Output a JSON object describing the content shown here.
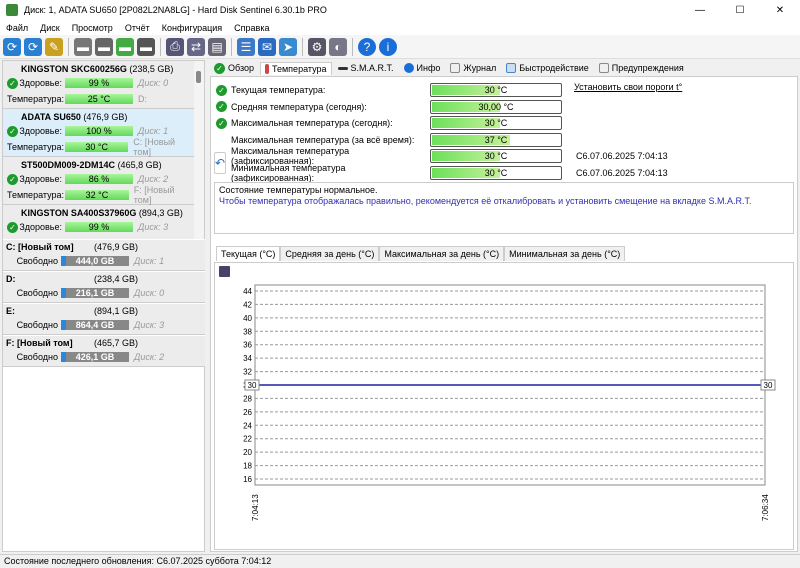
{
  "window": {
    "title": "Диск: 1, ADATA SU650 [2P082L2NA8LG]  -  Hard Disk Sentinel 6.30.1b PRO"
  },
  "menu": [
    "Файл",
    "Диск",
    "Просмотр",
    "Отчёт",
    "Конфигурация",
    "Справка"
  ],
  "disks": [
    {
      "name": "KINGSTON SKC600256G",
      "size": "(238,5 GB)",
      "health_label": "Здоровье:",
      "health": "99 %",
      "disk": "Диск: 0",
      "temp_label": "Температура:",
      "temp": "25 °C",
      "vol": "D:"
    },
    {
      "name": "ADATA SU650",
      "size": "(476,9 GB)",
      "health_label": "Здоровье:",
      "health": "100 %",
      "disk": "Диск: 1",
      "temp_label": "Температура:",
      "temp": "30 °C",
      "vol": "C: [Новый том]"
    },
    {
      "name": "ST500DM009-2DM14C",
      "size": "(465,8 GB)",
      "health_label": "Здоровье:",
      "health": "86 %",
      "disk": "Диск: 2",
      "temp_label": "Температура:",
      "temp": "32 °C",
      "vol": "F: [Новый том]"
    },
    {
      "name": "KINGSTON SA400S37960G",
      "size": "(894,3 GB)",
      "health_label": "Здоровье:",
      "health": "99 %",
      "disk": "Диск: 3"
    }
  ],
  "volumes": [
    {
      "name": "C: [Новый том]",
      "size": "(476,9 GB)",
      "free_label": "Свободно",
      "free": "444,0 GB",
      "disk": "Диск: 1"
    },
    {
      "name": "D:",
      "size": "(238,4 GB)",
      "free_label": "Свободно",
      "free": "216,1 GB",
      "disk": "Диск: 0"
    },
    {
      "name": "E:",
      "size": "(894,1 GB)",
      "free_label": "Свободно",
      "free": "864,4 GB",
      "disk": "Диск: 3"
    },
    {
      "name": "F: [Новый том]",
      "size": "(465,7 GB)",
      "free_label": "Свободно",
      "free": "426,1 GB",
      "disk": "Диск: 2"
    }
  ],
  "tabs": [
    "Обзор",
    "Температура",
    "S.M.A.R.T.",
    "Инфо",
    "Журнал",
    "Быстродействие",
    "Предупреждения"
  ],
  "temps": [
    {
      "label": "Текущая температура:",
      "value": "30 °C"
    },
    {
      "label": "Средняя температура (сегодня):",
      "value": "30,00 °C"
    },
    {
      "label": "Максимальная температура (сегодня):",
      "value": "30 °C"
    },
    {
      "label": "Максимальная температура (за всё время):",
      "value": "37 °C"
    },
    {
      "label": "Максимальная температура (зафиксированная):",
      "value": "30 °C",
      "time": "С6.07.06.2025 7:04:13"
    },
    {
      "label": "Минимальная температура (зафиксированная):",
      "value": "30 °C",
      "time": "С6.07.06.2025 7:04:13"
    }
  ],
  "threshold_link": "Установить свои пороги t°",
  "message": {
    "line1": "Состояние температуры нормальное.",
    "line2": "Чтобы температура отображалась правильно, рекомендуется её откалибровать и установить смещение на вкладке S.M.A.R.T."
  },
  "chart_tabs": [
    "Текущая (°C)",
    "Средняя за день (°C)",
    "Максимальная за день (°C)",
    "Минимальная за день (°C)"
  ],
  "chart_data": {
    "type": "line",
    "x": [
      "7:04:13",
      "7:06:34"
    ],
    "values": [
      30,
      30
    ],
    "ylim": [
      16,
      44
    ],
    "yticks": [
      16,
      18,
      20,
      22,
      24,
      26,
      28,
      30,
      32,
      34,
      36,
      38,
      40,
      42,
      44
    ],
    "start_label": "30",
    "end_label": "30",
    "grid": true
  },
  "status": "Состояние последнего обновления: С6.07.2025 суббота 7:04:12"
}
